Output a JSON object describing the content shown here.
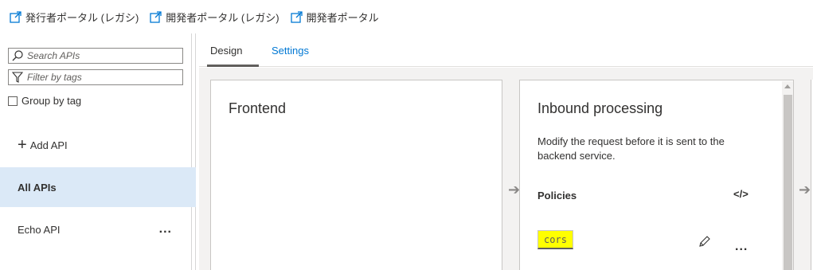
{
  "topbar": {
    "links": [
      {
        "label": "発行者ポータル (レガシ)",
        "icon": "external-link-icon"
      },
      {
        "label": "開発者ポータル (レガシ)",
        "icon": "external-link-icon"
      },
      {
        "label": "開発者ポータル",
        "icon": "external-link-icon"
      }
    ]
  },
  "sidebar": {
    "search_placeholder": "Search APIs",
    "filter_placeholder": "Filter by tags",
    "group_by_tag": "Group by tag",
    "add_api": "Add API",
    "apis": [
      {
        "label": "All APIs",
        "active": true
      },
      {
        "label": "Echo API",
        "active": false,
        "more": "..."
      }
    ]
  },
  "tabs": {
    "design": "Design",
    "settings": "Settings"
  },
  "canvas": {
    "frontend": {
      "title": "Frontend"
    },
    "inbound": {
      "title": "Inbound processing",
      "description": "Modify the request before it is sent to the backend service.",
      "policies_label": "Policies",
      "code_icon_glyph": "</>",
      "policy_tag": "cors",
      "more": "..."
    },
    "flow_arrow": "➔"
  },
  "colors": {
    "accent": "#0078d4",
    "active_item_bg": "#dbe9f7",
    "cors_highlight": "#ffff00",
    "canvas_bg": "#f3f2f1"
  }
}
